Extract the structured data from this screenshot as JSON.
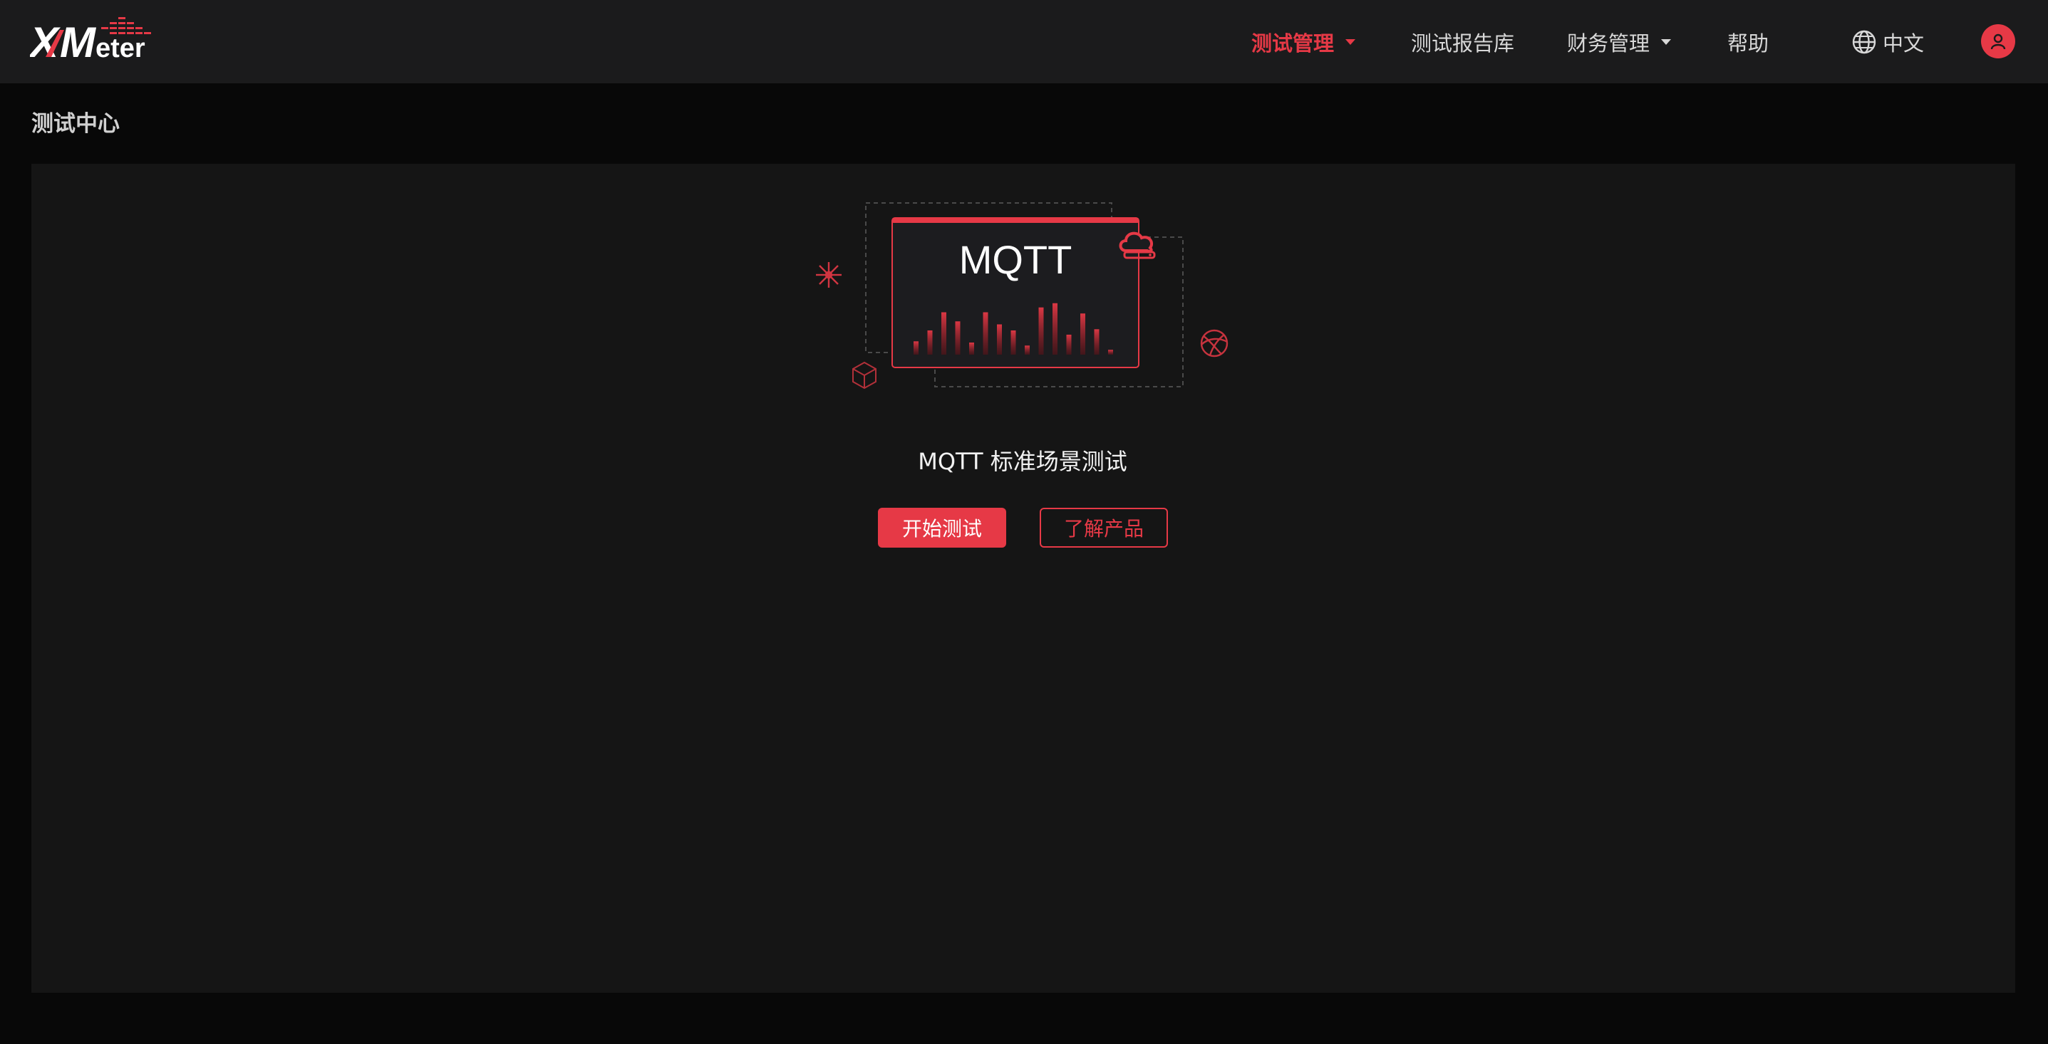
{
  "header": {
    "logo_text": "XMeter",
    "nav": [
      {
        "label": "测试管理",
        "active": true,
        "has_dropdown": true
      },
      {
        "label": "测试报告库",
        "active": false,
        "has_dropdown": false
      },
      {
        "label": "财务管理",
        "active": false,
        "has_dropdown": true
      },
      {
        "label": "帮助",
        "active": false,
        "has_dropdown": false
      }
    ],
    "language": {
      "icon": "globe-icon",
      "label": "中文"
    },
    "user_icon": "user-icon"
  },
  "breadcrumb": "测试中心",
  "scenario": {
    "card_label": "MQTT",
    "title": "MQTT 标准场景测试",
    "start_button": "开始测试",
    "learn_button": "了解产品",
    "bar_levels": [
      0.22,
      0.4,
      0.7,
      0.55,
      0.2,
      0.7,
      0.5,
      0.4,
      0.15,
      0.78,
      0.85,
      0.33,
      0.68,
      0.42,
      0.08
    ]
  },
  "colors": {
    "accent": "#e63946",
    "header_bg": "#1b1b1c",
    "page_bg": "#080808",
    "panel_bg": "#151515"
  }
}
